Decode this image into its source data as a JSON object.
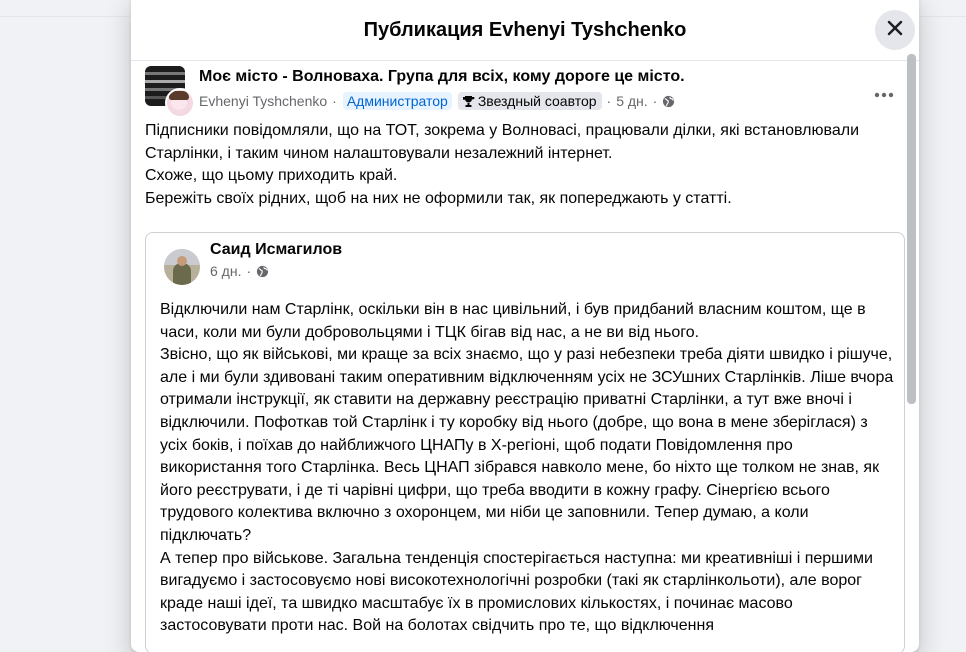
{
  "dialog": {
    "title": "Публикация Evhenyi Tyshchenko",
    "close_icon": "close-icon"
  },
  "post": {
    "group_name": "Моє місто - Волноваха. Група для всіх, кому дороге це місто.",
    "author": "Evhenyi Tyshchenko",
    "sep": "·",
    "role_badge": "Администратор",
    "star_badge": "Звездный соавтор",
    "time": "5 дн.",
    "privacy_icon": "globe-icon",
    "more_icon": "more-options-icon",
    "text": [
      "Підписники повідомляли, що на ТОТ, зокрема у Волновасі, працювали ділки, які встановлювали Старлінки, і таким чином налаштовували незалежний інтернет.",
      "Схоже, що цьому приходить край.",
      "Бережіть своїх рідних, щоб на них не оформили так, як попереджають у статті."
    ]
  },
  "shared": {
    "author": "Саид Исмагилов",
    "time": "6 дн.",
    "text": [
      "Відключили нам Старлінк, оскільки він в нас цивільний, і був придбаний власним коштом, ще в часи, коли ми були добровольцями і ТЦК бігав від нас, а не ви від нього.",
      "Звісно, що як військові, ми краще за всіх знаємо, що у разі небезпеки треба діяти швидко і рішуче, але і ми були здивовані таким оперативним відключенням усіх не ЗСУшних Старлінків. Ліше вчора отримали інструкції, як ставити на державну реєстрацію приватні Старлінки, а тут вже вночі і відключили. Пофоткав той Старлінк і ту коробку від нього (добре, що вона в мене зберіглася) з усіх боків, і поїхав до найближчого ЦНАПу в Х-регіоні, щоб подати Повідомлення про використання  того Старлінка. Весь ЦНАП зібрався навколо мене, бо ніхто ще толком не знав, як його реєструвати, і де ті чарівні цифри, що треба вводити в кожну графу.   Сінергією всього трудового колектива включно з охоронцем, ми ніби це заповнили. Тепер думаю, а коли підключать?",
      "А тепер про військове. Загальна тенденція спостерігається наступна: ми креативніші і першими вигадуємо і застосовуємо нові високотехнологічні розробки (такі як старлінкольоти), але ворог краде наші ідеї, та швидко масштабує їх в промислових кількостях, і починає масово застосовувати проти нас. Вой на болотах свідчить про те, що відключення"
    ]
  }
}
